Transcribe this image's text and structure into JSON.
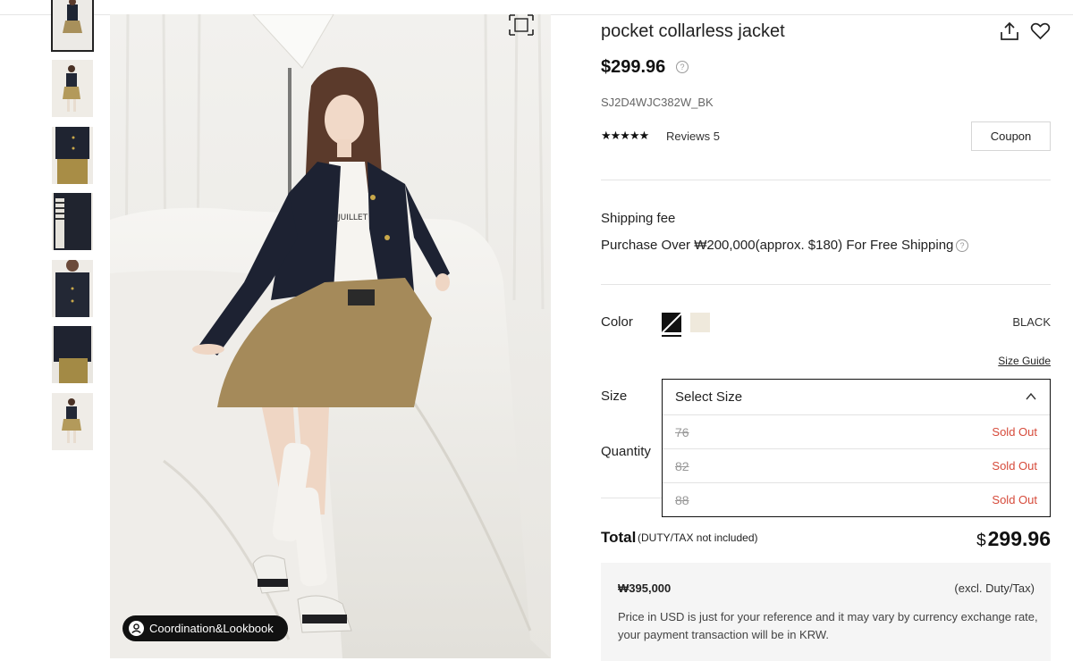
{
  "thumbnails": [
    {
      "alt": "thumb-1"
    },
    {
      "alt": "thumb-2"
    },
    {
      "alt": "thumb-3"
    },
    {
      "alt": "thumb-4"
    },
    {
      "alt": "thumb-5"
    },
    {
      "alt": "thumb-6"
    },
    {
      "alt": "thumb-7"
    }
  ],
  "gallery": {
    "lookbook_label": "Coordination&Lookbook",
    "fullscreen_icon": "expand-icon"
  },
  "product": {
    "title": "pocket collarless jacket",
    "price": "$299.96",
    "sku": "SJ2D4WJC382W_BK",
    "stars": "★★★★★",
    "reviews_label": "Reviews 5",
    "coupon_label": "Coupon"
  },
  "shipping": {
    "label": "Shipping fee",
    "text": "Purchase Over ₩200,000(approx. $180) For Free Shipping"
  },
  "color": {
    "label": "Color",
    "selected": "BLACK",
    "swatches": [
      {
        "name": "black",
        "hex": "#111111"
      },
      {
        "name": "cream",
        "hex": "#efe9dc"
      }
    ]
  },
  "size": {
    "guide_label": "Size Guide",
    "label": "Size",
    "placeholder": "Select Size",
    "options": [
      {
        "value": "76",
        "status": "Sold Out"
      },
      {
        "value": "82",
        "status": "Sold Out"
      },
      {
        "value": "88",
        "status": "Sold Out"
      }
    ]
  },
  "quantity": {
    "label": "Quantity"
  },
  "total": {
    "label": "Total",
    "note": "(DUTY/TAX not included)",
    "currency": "$",
    "amount": "299.96"
  },
  "krw": {
    "price": "₩395,000",
    "note": "(excl. Duty/Tax)",
    "description": "Price in USD is just for your reference and it may vary by currency exchange rate, your payment transaction will be in KRW."
  },
  "colors": {
    "accent": "#111111",
    "sold_out": "#d64a3a",
    "panel_bg": "#f5f5f5"
  }
}
